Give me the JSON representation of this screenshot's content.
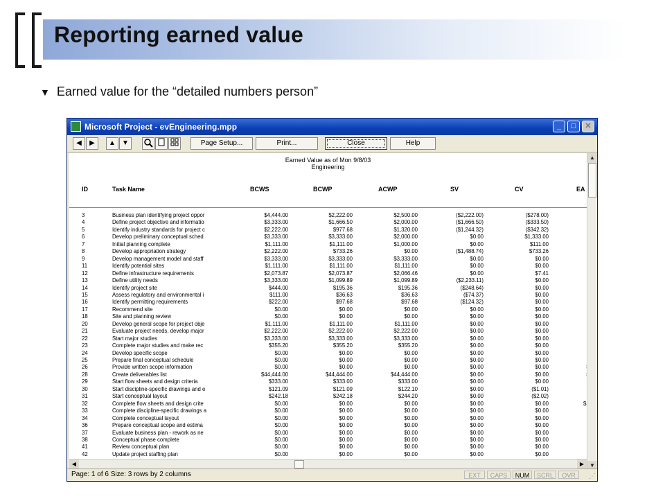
{
  "slide": {
    "title": "Reporting earned value",
    "bullet_marker": "▼",
    "bullet": "Earned value for the “detailed numbers person”"
  },
  "window": {
    "title": "Microsoft Project - evEngineering.mpp",
    "controls": {
      "minimize": "_",
      "maximize": "□",
      "close": "✕"
    }
  },
  "toolbar": {
    "prev_page": "◀",
    "next_page": "▶",
    "up_page": "▲",
    "down_page": "▼",
    "page_setup": "Page Setup...",
    "print": "Print...",
    "close": "Close",
    "help": "Help"
  },
  "report": {
    "title": "Earned Value as of Mon 9/8/03",
    "subtitle": "Engineering",
    "columns": [
      "ID",
      "Task Name",
      "BCWS",
      "BCWP",
      "ACWP",
      "SV",
      "CV",
      "EA"
    ],
    "rows": [
      [
        "3",
        "Business plan identifying project oppor",
        "$4,444.00",
        "$2,222.00",
        "$2,500.00",
        "($2,222.00)",
        "($278.00)",
        "$"
      ],
      [
        "4",
        "Define project objective and informatio",
        "$3,333.00",
        "$1,666.50",
        "$2,000.00",
        "($1,666.50)",
        "($333.50)",
        "$"
      ],
      [
        "5",
        "Identify industry standards for project c",
        "$2,222.00",
        "$977.68",
        "$1,320.00",
        "($1,244.32)",
        "($342.32)",
        "$"
      ],
      [
        "6",
        "Develop preliminary conceptual sched",
        "$3,333.00",
        "$3,333.00",
        "$2,000.00",
        "$0.00",
        "$1,333.00",
        "$"
      ],
      [
        "7",
        "Initial planning complete",
        "$1,111.00",
        "$1,111.00",
        "$1,000.00",
        "$0.00",
        "$111.00",
        "$"
      ],
      [
        "8",
        "Develop appropriation strategy",
        "$2,222.00",
        "$733.26",
        "$0.00",
        "($1,488.74)",
        "$733.26",
        ""
      ],
      [
        "9",
        "Develop management model and staff",
        "$3,333.00",
        "$3,333.00",
        "$3,333.00",
        "$0.00",
        "$0.00",
        "$"
      ],
      [
        "11",
        "Identify potential sites",
        "$1,111.00",
        "$1,111.00",
        "$1,111.00",
        "$0.00",
        "$0.00",
        "$"
      ],
      [
        "12",
        "Define infrastructure requirements",
        "$2,073.87",
        "$2,073.87",
        "$2,066.46",
        "$0.00",
        "$7.41",
        "$"
      ],
      [
        "13",
        "Define utility needs",
        "$3,333.00",
        "$1,099.89",
        "$1,099.89",
        "($2,233.11)",
        "$0.00",
        "$"
      ],
      [
        "14",
        "Identify project site",
        "$444.00",
        "$195.36",
        "$195.36",
        "($248.64)",
        "$0.00",
        ""
      ],
      [
        "15",
        "Assess regulatory and environmental i",
        "$111.00",
        "$36.63",
        "$36.63",
        "($74.37)",
        "$0.00",
        ""
      ],
      [
        "16",
        "Identify permitting requirements",
        "$222.00",
        "$97.68",
        "$97.68",
        "($124.32)",
        "$0.00",
        ""
      ],
      [
        "17",
        "Recommend site",
        "$0.00",
        "$0.00",
        "$0.00",
        "$0.00",
        "$0.00",
        "$"
      ],
      [
        "18",
        "Site and planning review",
        "$0.00",
        "$0.00",
        "$0.00",
        "$0.00",
        "$0.00",
        "$"
      ],
      [
        "20",
        "Develop general scope for project obje",
        "$1,111.00",
        "$1,111.00",
        "$1,111.00",
        "$0.00",
        "$0.00",
        "$"
      ],
      [
        "21",
        "Evaluate project needs, develop major",
        "$2,222.00",
        "$2,222.00",
        "$2,222.00",
        "$0.00",
        "$0.00",
        "$"
      ],
      [
        "22",
        "Start major studies",
        "$3,333.00",
        "$3,333.00",
        "$3,333.00",
        "$0.00",
        "$0.00",
        "$"
      ],
      [
        "23",
        "Complete major studies and make rec",
        "$355.20",
        "$355.20",
        "$355.20",
        "$0.00",
        "$0.00",
        ""
      ],
      [
        "24",
        "Develop specific scope",
        "$0.00",
        "$0.00",
        "$0.00",
        "$0.00",
        "$0.00",
        ""
      ],
      [
        "25",
        "Prepare final conceptual schedule",
        "$0.00",
        "$0.00",
        "$0.00",
        "$0.00",
        "$0.00",
        ""
      ],
      [
        "26",
        "Provide written scope information",
        "$0.00",
        "$0.00",
        "$0.00",
        "$0.00",
        "$0.00",
        "$1"
      ],
      [
        "28",
        "Create deliverables list",
        "$44,444.00",
        "$44,444.00",
        "$44,444.00",
        "$0.00",
        "$0.00",
        "$4"
      ],
      [
        "29",
        "Start flow sheets and design criteria",
        "$333.00",
        "$333.00",
        "$333.00",
        "$0.00",
        "$0.00",
        ""
      ],
      [
        "30",
        "Start discipline-specific drawings and e",
        "$121.09",
        "$121.09",
        "$122.10",
        "$0.00",
        "($1.01)",
        ""
      ],
      [
        "31",
        "Start conceptual layout",
        "$242.18",
        "$242.18",
        "$244.20",
        "$0.00",
        "($2.02)",
        ""
      ],
      [
        "32",
        "Complete flow sheets and design crite",
        "$0.00",
        "$0.00",
        "$0.00",
        "$0.00",
        "$0.00",
        "$33"
      ],
      [
        "33",
        "Complete discipline-specific drawings a",
        "$0.00",
        "$0.00",
        "$0.00",
        "$0.00",
        "$0.00",
        ""
      ],
      [
        "34",
        "Complete conceptual layout",
        "$0.00",
        "$0.00",
        "$0.00",
        "$0.00",
        "$0.00",
        "$"
      ],
      [
        "36",
        "Prepare conceptual scope and estima",
        "$0.00",
        "$0.00",
        "$0.00",
        "$0.00",
        "$0.00",
        "$"
      ],
      [
        "37",
        "Evaluate business plan - rework as ne",
        "$0.00",
        "$0.00",
        "$0.00",
        "$0.00",
        "$0.00",
        "$"
      ],
      [
        "38",
        "Conceptual phase complete",
        "$0.00",
        "$0.00",
        "$0.00",
        "$0.00",
        "$0.00",
        ""
      ],
      [
        "41",
        "Review conceptual plan",
        "$0.00",
        "$0.00",
        "$0.00",
        "$0.00",
        "$0.00",
        "$"
      ],
      [
        "42",
        "Update project staffing plan",
        "$0.00",
        "$0.00",
        "$0.00",
        "$0.00",
        "$0.00",
        "$"
      ]
    ]
  },
  "statusbar": {
    "text": "Page: 1 of 6   Size: 3 rows by 2 columns",
    "indicators": [
      "EXT",
      "CAPS",
      "NUM",
      "SCRL",
      "OVR"
    ],
    "active_indicator": "NUM"
  }
}
